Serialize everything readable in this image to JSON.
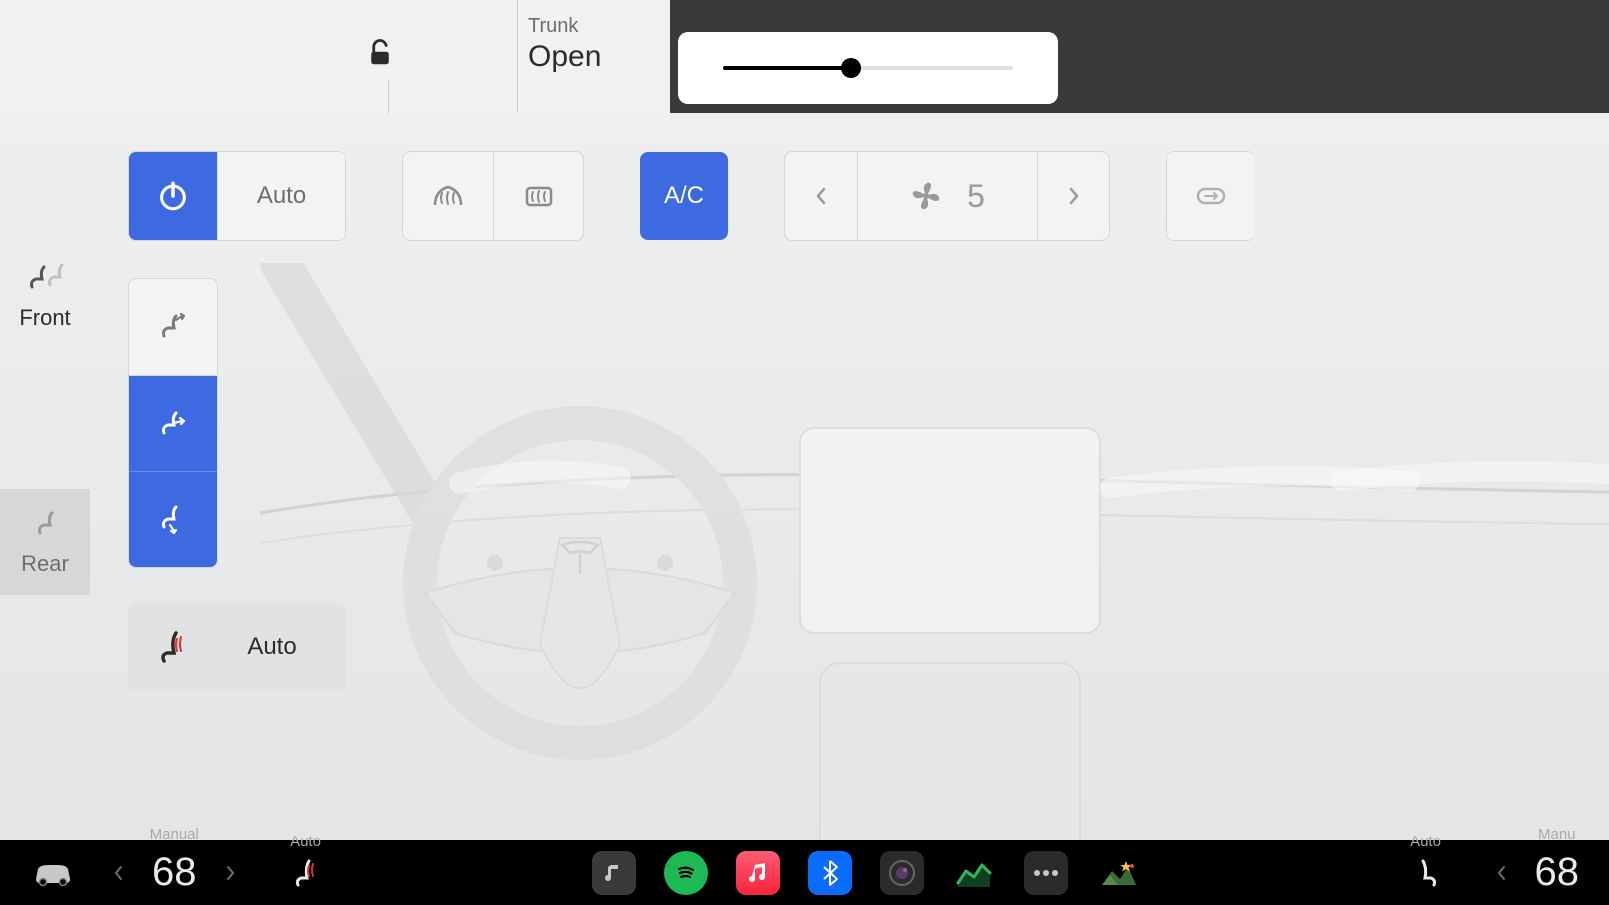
{
  "header": {
    "trunk_label": "Trunk",
    "trunk_status": "Open"
  },
  "slider": {
    "value_percent": 44
  },
  "sidebar": {
    "front_label": "Front",
    "rear_label": "Rear"
  },
  "controls": {
    "power_active": true,
    "auto_label": "Auto",
    "ac_label": "A/C",
    "ac_active": true,
    "fan_speed": "5",
    "airflow": {
      "face_active": false,
      "mid_active": true,
      "feet_active": true
    },
    "seat_auto_label": "Auto"
  },
  "bottom_bar": {
    "left_mode": "Manual",
    "left_temp": "68",
    "seat_left_label": "Auto",
    "seat_right_label": "Auto",
    "right_mode": "Manu",
    "right_temp": "68",
    "apps": [
      {
        "id": "music",
        "bg": "#3a3a3a"
      },
      {
        "id": "spotify",
        "bg": "#1db954"
      },
      {
        "id": "apple-music",
        "bg": "#fa2d48"
      },
      {
        "id": "bluetooth",
        "bg": "#0a6cff"
      },
      {
        "id": "camera",
        "bg": "#2b2b2b"
      },
      {
        "id": "stocks",
        "bg": "#000"
      },
      {
        "id": "more",
        "bg": "#2b2b2b"
      },
      {
        "id": "scenery",
        "bg": "#000"
      }
    ]
  }
}
